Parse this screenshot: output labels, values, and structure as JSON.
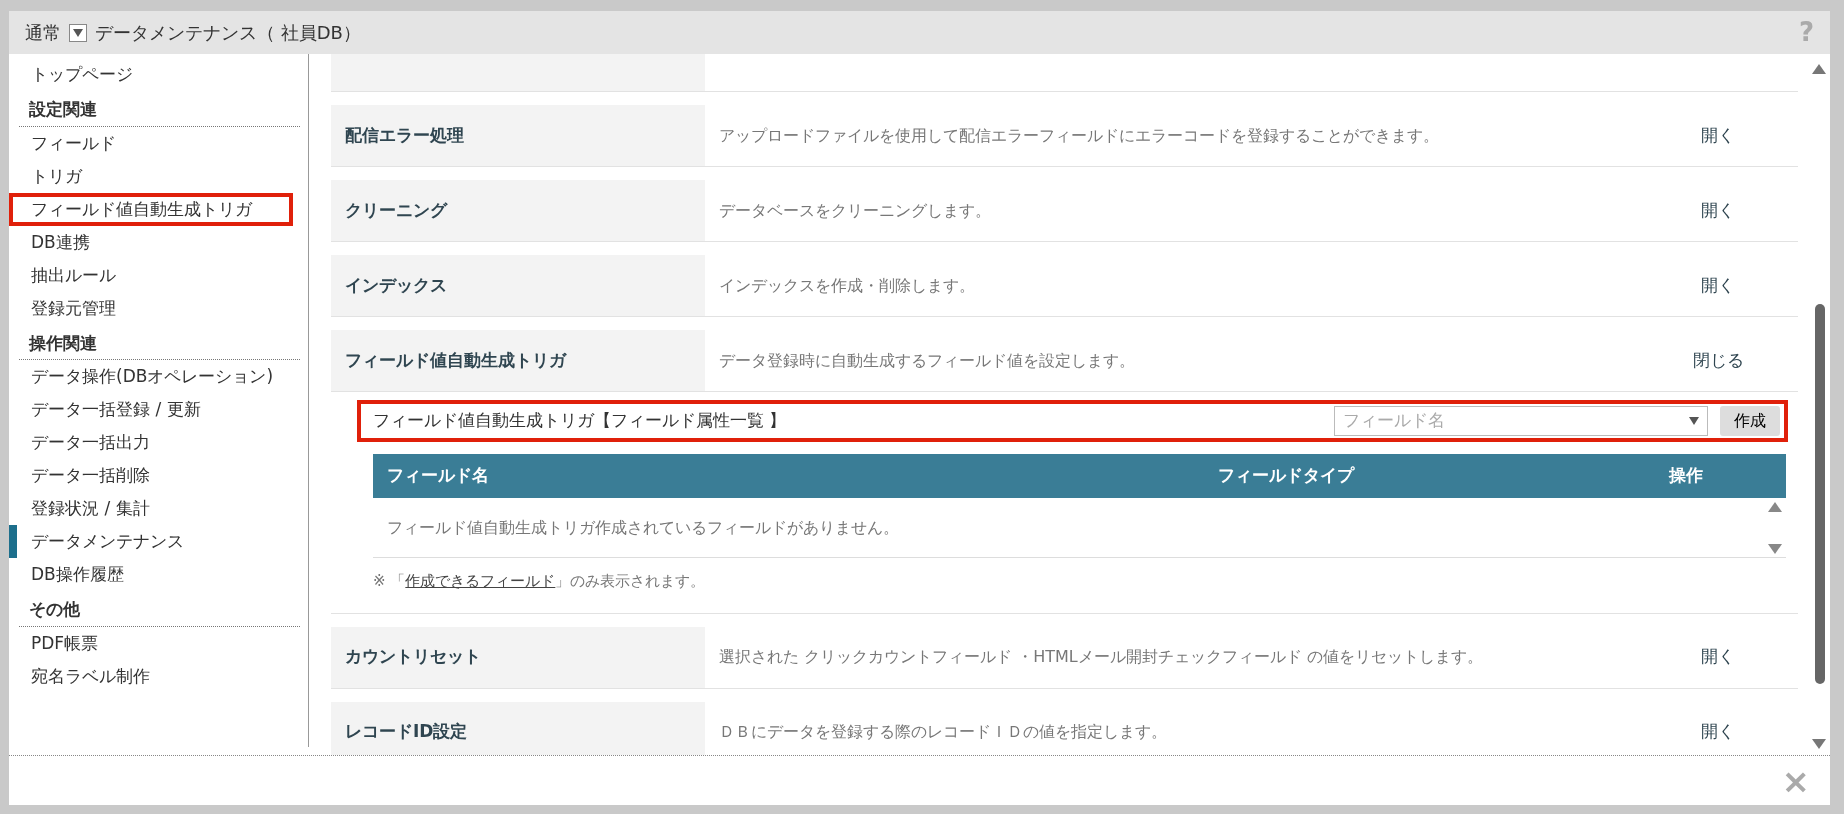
{
  "header": {
    "mode": "通常",
    "title": "データメンテナンス（ 社員DB）",
    "help": "?"
  },
  "sidebar": {
    "items": [
      {
        "kind": "link",
        "label": "トップページ",
        "selected": false,
        "highlighted": false
      },
      {
        "kind": "heading",
        "label": "設定関連"
      },
      {
        "kind": "link",
        "label": "フィールド",
        "selected": false,
        "highlighted": false
      },
      {
        "kind": "link",
        "label": "トリガ",
        "selected": false,
        "highlighted": false
      },
      {
        "kind": "link",
        "label": "フィールド値自動生成トリガ",
        "selected": false,
        "highlighted": true
      },
      {
        "kind": "link",
        "label": "DB連携",
        "selected": false,
        "highlighted": false
      },
      {
        "kind": "link",
        "label": "抽出ルール",
        "selected": false,
        "highlighted": false
      },
      {
        "kind": "link",
        "label": "登録元管理",
        "selected": false,
        "highlighted": false
      },
      {
        "kind": "heading",
        "label": "操作関連"
      },
      {
        "kind": "link",
        "label": "データ操作(DBオペレーション)",
        "selected": false,
        "highlighted": false
      },
      {
        "kind": "link",
        "label": "データ一括登録 / 更新",
        "selected": false,
        "highlighted": false
      },
      {
        "kind": "link",
        "label": "データ一括出力",
        "selected": false,
        "highlighted": false
      },
      {
        "kind": "link",
        "label": "データ一括削除",
        "selected": false,
        "highlighted": false
      },
      {
        "kind": "link",
        "label": "登録状況 / 集計",
        "selected": false,
        "highlighted": false
      },
      {
        "kind": "link",
        "label": "データメンテナンス",
        "selected": true,
        "highlighted": false
      },
      {
        "kind": "link",
        "label": "DB操作履歴",
        "selected": false,
        "highlighted": false
      },
      {
        "kind": "heading",
        "label": "その他"
      },
      {
        "kind": "link",
        "label": "PDF帳票",
        "selected": false,
        "highlighted": false
      },
      {
        "kind": "link",
        "label": "宛名ラベル制作",
        "selected": false,
        "highlighted": false
      }
    ]
  },
  "sections": [
    {
      "title": "配信エラー処理",
      "description": "アップロードファイルを使用して配信エラーフィールドにエラーコードを登録することができます。",
      "action": "開く"
    },
    {
      "title": "クリーニング",
      "description": "データベースをクリーニングします。",
      "action": "開く"
    },
    {
      "title": "インデックス",
      "description": "インデックスを作成・削除します。",
      "action": "開く"
    },
    {
      "title": "フィールド値自動生成トリガ",
      "description": "データ登録時に自動生成するフィールド値を設定します。",
      "action": "閉じる",
      "panel": {
        "title": "フィールド値自動生成トリガ【フィールド属性一覧 】",
        "highlighted": true,
        "select": {
          "placeholder": "フィールド名"
        },
        "button": "作成",
        "table": {
          "columns": [
            "フィールド名",
            "フィールドタイプ",
            "操作"
          ],
          "empty_message": "フィールド値自動生成トリガ作成されているフィールドがありません。"
        },
        "note": {
          "prefix": "※ 「",
          "link": "作成できるフィールド",
          "suffix": "」のみ表示されます。"
        }
      }
    },
    {
      "title": "カウントリセット",
      "description": "選択された クリックカウントフィールド ・HTMLメール開封チェックフィールド の値をリセットします。",
      "action": "開く"
    },
    {
      "title": "レコードID設定",
      "description": "ＤＢにデータを登録する際のレコードＩＤの値を指定します。",
      "action": "開く"
    }
  ],
  "footer": {
    "close": "×"
  }
}
